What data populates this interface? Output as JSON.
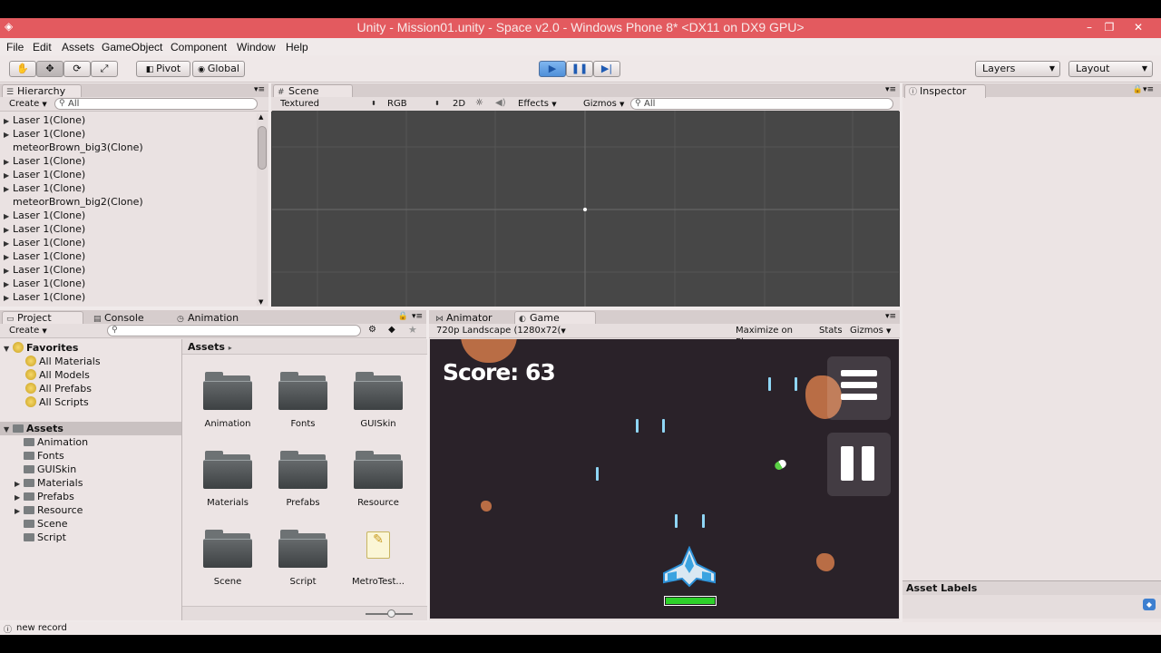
{
  "window": {
    "title": "Unity - Mission01.unity - Space v2.0 - Windows Phone 8* <DX11 on DX9 GPU>",
    "minimize": "–",
    "restore": "❐",
    "close": "✕"
  },
  "menubar": [
    "File",
    "Edit",
    "Assets",
    "GameObject",
    "Component",
    "Window",
    "Help"
  ],
  "toolbar": {
    "pivot": "Pivot",
    "global": "Global",
    "layers": "Layers",
    "layout": "Layout"
  },
  "hierarchy": {
    "tab": "Hierarchy",
    "create": "Create",
    "search_placeholder": "All",
    "items": [
      {
        "label": "Laser 1(Clone)",
        "expand": true
      },
      {
        "label": "Laser 1(Clone)",
        "expand": true
      },
      {
        "label": "meteorBrown_big3(Clone)",
        "expand": false
      },
      {
        "label": "Laser 1(Clone)",
        "expand": true
      },
      {
        "label": "Laser 1(Clone)",
        "expand": true
      },
      {
        "label": "Laser 1(Clone)",
        "expand": true
      },
      {
        "label": "meteorBrown_big2(Clone)",
        "expand": false
      },
      {
        "label": "Laser 1(Clone)",
        "expand": true
      },
      {
        "label": "Laser 1(Clone)",
        "expand": true
      },
      {
        "label": "Laser 1(Clone)",
        "expand": true
      },
      {
        "label": "Laser 1(Clone)",
        "expand": true
      },
      {
        "label": "Laser 1(Clone)",
        "expand": true
      },
      {
        "label": "Laser 1(Clone)",
        "expand": true
      },
      {
        "label": "Laser 1(Clone)",
        "expand": true
      }
    ]
  },
  "scene": {
    "tab": "Scene",
    "shading": "Textured",
    "render": "RGB",
    "mode2d": "2D",
    "effects": "Effects",
    "gizmos": "Gizmos",
    "search_placeholder": "All"
  },
  "project": {
    "tabs": [
      "Project",
      "Console",
      "Animation"
    ],
    "create": "Create",
    "favorites_label": "Favorites",
    "favorites": [
      "All Materials",
      "All Models",
      "All Prefabs",
      "All Scripts"
    ],
    "assets_label": "Assets",
    "asset_tree": [
      {
        "label": "Animation",
        "expand": false
      },
      {
        "label": "Fonts",
        "expand": false
      },
      {
        "label": "GUISkin",
        "expand": false
      },
      {
        "label": "Materials",
        "expand": true
      },
      {
        "label": "Prefabs",
        "expand": true
      },
      {
        "label": "Resource",
        "expand": true
      },
      {
        "label": "Scene",
        "expand": false
      },
      {
        "label": "Script",
        "expand": false
      }
    ],
    "breadcrumb": "Assets",
    "grid": [
      "Animation",
      "Fonts",
      "GUISkin",
      "Materials",
      "Prefabs",
      "Resource",
      "Scene",
      "Script",
      "MetroTest..."
    ]
  },
  "animator_tab": "Animator",
  "game": {
    "tab": "Game",
    "resolution": "720p Landscape (1280x72(",
    "maximize": "Maximize on Play",
    "stats": "Stats",
    "gizmos": "Gizmos",
    "score": "Score: 63",
    "health": 1.0
  },
  "inspector": {
    "tab": "Inspector",
    "asset_labels": "Asset Labels"
  },
  "status": "new record"
}
